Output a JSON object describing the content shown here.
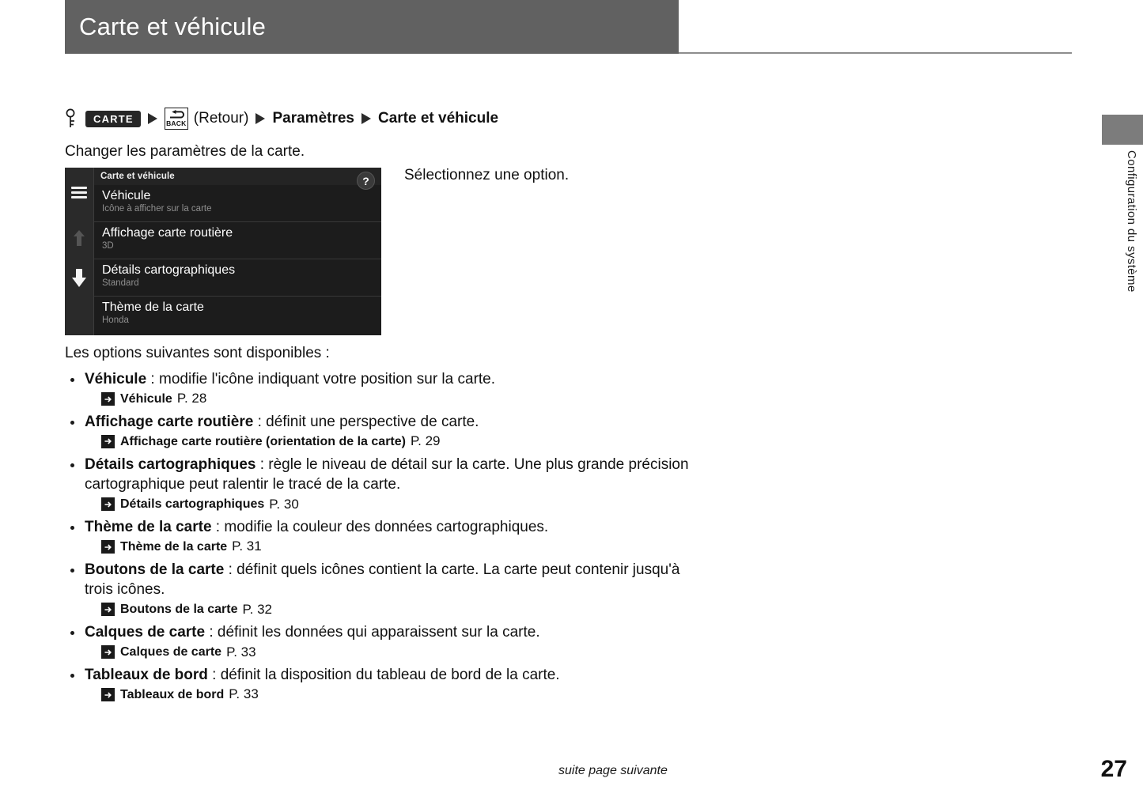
{
  "header": {
    "title": "Carte et véhicule"
  },
  "side_tab": {
    "label": "Configuration du système"
  },
  "breadcrumb": {
    "key_icon": "key-icon",
    "carte_button": "CARTE",
    "back_icon_label": "BACK",
    "retour_label": "(Retour)",
    "parametres_label": "Paramètres",
    "final_label": "Carte et véhicule",
    "separator": "▶"
  },
  "intro": {
    "text": "Changer les paramètres de la carte."
  },
  "right_caption": {
    "text": "Sélectionnez une option."
  },
  "nav_screen": {
    "title": "Carte et véhicule",
    "help_label": "?",
    "rows": [
      {
        "title": "Véhicule",
        "subtitle": "Icône à afficher sur la carte"
      },
      {
        "title": "Affichage carte routière",
        "subtitle": "3D"
      },
      {
        "title": "Détails cartographiques",
        "subtitle": "Standard"
      },
      {
        "title": "Thème de la carte",
        "subtitle": "Honda"
      }
    ]
  },
  "body": {
    "lead": "Les options suivantes sont disponibles :",
    "items": [
      {
        "term": "Véhicule",
        "desc": " : modifie l'icône indiquant votre position sur la carte.",
        "ref_term": "Véhicule",
        "ref_page": "P. 28"
      },
      {
        "term": "Affichage carte routière",
        "desc": " : définit une perspective de carte.",
        "ref_term": "Affichage carte routière (orientation de la carte)",
        "ref_page": "P. 29"
      },
      {
        "term": "Détails cartographiques",
        "desc": " : règle le niveau de détail sur la carte. Une plus grande précision cartographique peut ralentir le tracé de la carte.",
        "ref_term": "Détails cartographiques",
        "ref_page": "P. 30"
      },
      {
        "term": "Thème de la carte",
        "desc": " : modifie la couleur des données cartographiques.",
        "ref_term": "Thème de la carte",
        "ref_page": "P. 31"
      },
      {
        "term": "Boutons de la carte",
        "desc": " : définit quels icônes contient la carte. La carte peut contenir jusqu'à trois icônes.",
        "ref_term": "Boutons de la carte",
        "ref_page": "P. 32"
      },
      {
        "term": "Calques de carte",
        "desc": " : définit les données qui apparaissent sur la carte.",
        "ref_term": "Calques de carte",
        "ref_page": "P. 33"
      },
      {
        "term": "Tableaux de bord",
        "desc": " : définit la disposition du tableau de bord de la carte.",
        "ref_term": "Tableaux de bord",
        "ref_page": "P. 33"
      }
    ]
  },
  "footer": {
    "continuation": "suite page suivante",
    "page_number": "27"
  },
  "colors": {
    "header_gray": "#616161",
    "side_tab_gray": "#7c7c7c",
    "nav_screen_bg": "#1c1c1c",
    "text_black": "#111111"
  }
}
